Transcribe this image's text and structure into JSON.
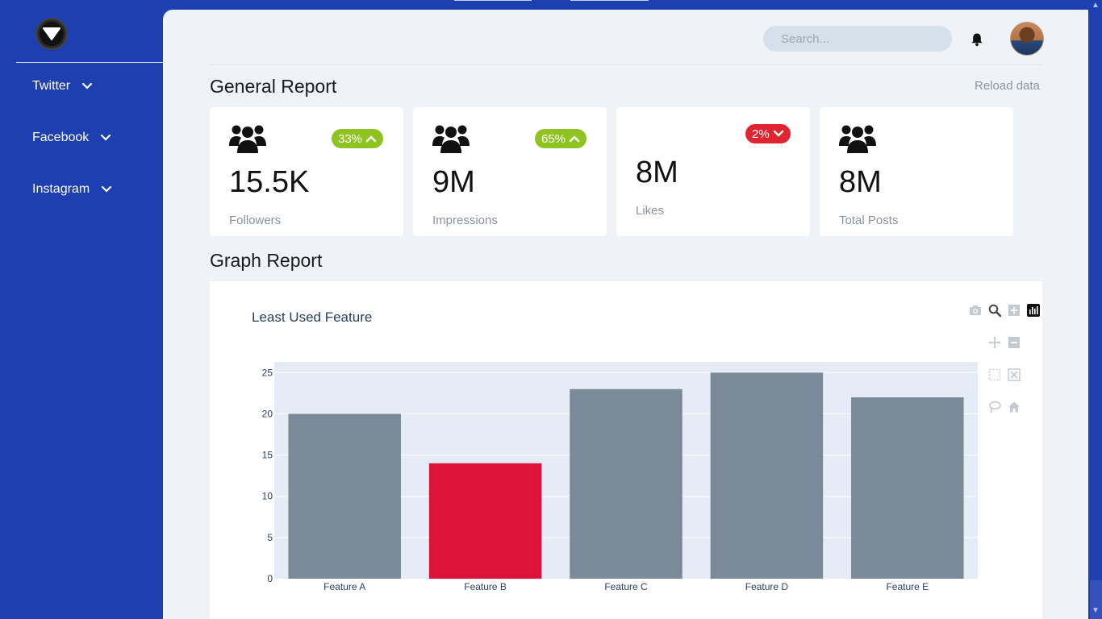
{
  "sidebar": {
    "items": [
      {
        "label": "Twitter"
      },
      {
        "label": "Facebook"
      },
      {
        "label": "Instagram"
      }
    ]
  },
  "header": {
    "search_placeholder": "Search..."
  },
  "general_report": {
    "title": "General Report",
    "reload_label": "Reload data",
    "cards": [
      {
        "value": "15.5K",
        "label": "Followers",
        "badge": "33%",
        "trend": "up"
      },
      {
        "value": "9M",
        "label": "Impressions",
        "badge": "65%",
        "trend": "up"
      },
      {
        "value": "8M",
        "label": "Likes",
        "badge": "2%",
        "trend": "down"
      },
      {
        "value": "8M",
        "label": "Total Posts",
        "badge": "",
        "trend": "none"
      }
    ]
  },
  "graph_report": {
    "title": "Graph Report"
  },
  "colors": {
    "sidebar": "#1d3fb0",
    "badge_up": "#8fc31f",
    "badge_down": "#e02430",
    "bar_default": "#7a8a99",
    "bar_highlight": "#dc143c",
    "plot_bg": "#e5ecf6"
  },
  "chart_data": {
    "type": "bar",
    "title": "Least Used Feature",
    "categories": [
      "Feature A",
      "Feature B",
      "Feature C",
      "Feature D",
      "Feature E"
    ],
    "values": [
      20,
      14,
      23,
      25,
      22
    ],
    "highlight_index": 1,
    "ylim": [
      0,
      26.3
    ],
    "yticks": [
      0,
      5,
      10,
      15,
      20,
      25
    ],
    "grid": true,
    "xlabel": "",
    "ylabel": ""
  }
}
